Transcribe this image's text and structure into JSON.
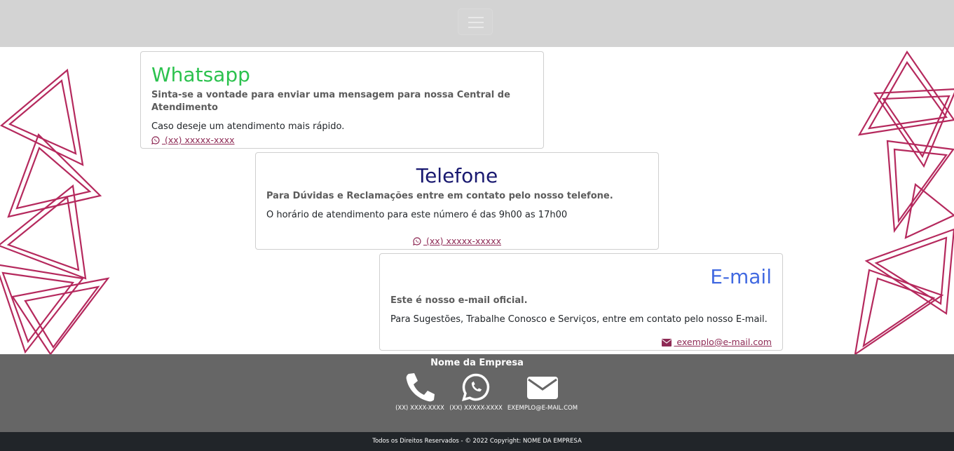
{
  "nav": {
    "toggle_icon": "hamburger-menu-icon"
  },
  "cards": {
    "whatsapp": {
      "title": "Whatsapp",
      "subtitle": "Sinta-se a vontade para enviar uma mensagem para nossa Central de Atendimento",
      "text": "Caso deseje um atendimento mais rápido.",
      "link": " (xx) xxxxx-xxxx",
      "icon": "whatsapp-icon",
      "title_color": "#2cc24e"
    },
    "telefone": {
      "title": "Telefone",
      "subtitle": "Para Dúvidas e Reclamações entre em contato pelo nosso telefone.",
      "text": "O horário de atendimento para este número é das 9h00 as 17h00",
      "link": " (xx) xxxxx-xxxxx",
      "icon": "whatsapp-icon",
      "title_color": "#191970"
    },
    "email": {
      "title": "E-mail",
      "subtitle": "Este é nosso e-mail oficial.",
      "text": "Para Sugestões, Trabalhe Conosco e Serviços, entre em contato pelo nosso E-mail.",
      "link": " exemplo@e-mail.com",
      "icon": "envelope-icon",
      "title_color": "#4169e1"
    }
  },
  "footer": {
    "title": "Nome da Empresa",
    "contacts": [
      {
        "icon": "phone-icon",
        "label": "(XX) XXXX-XXXX"
      },
      {
        "icon": "whatsapp-icon",
        "label": "(XX) XXXXX-XXXX"
      },
      {
        "icon": "envelope-icon",
        "label": "EXEMPLO@E-MAIL.COM"
      }
    ],
    "copyright": "Todos os Direitos Reservados - © 2022 Copyright: NOME DA EMPRESA"
  },
  "colors": {
    "decoration": "#b5295d",
    "link": "#8e2a55",
    "footer_bg": "#666666",
    "bottom_bg": "#212529"
  }
}
